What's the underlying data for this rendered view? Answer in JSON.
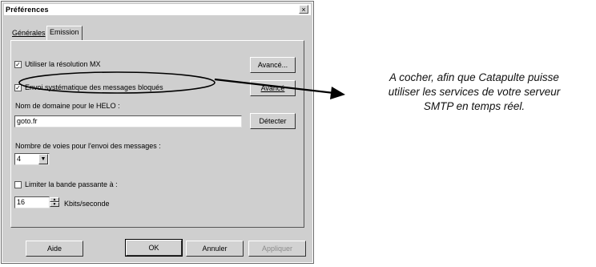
{
  "dialog": {
    "title": "Préférences",
    "close_label": "×",
    "tabs": [
      {
        "label": "Générales"
      },
      {
        "label": "Emission"
      }
    ],
    "checkbox_mx": {
      "label": "Utiliser la résolution MX",
      "checked": true
    },
    "checkbox_batch": {
      "label": "Envoi systématique des messages bloqués",
      "checked": true
    },
    "button_advanced_1": "Avancé...",
    "button_advanced_2": "Avancé",
    "helo_label": "Nom de domaine pour le HELO :",
    "helo_value": "goto.fr",
    "button_detect": "Détecter",
    "routes_label": "Nombre de voies pour l'envoi des messages :",
    "routes_value": "4",
    "checkbox_bandwidth": {
      "label": "Limiter la bande passante à :",
      "checked": false
    },
    "bandwidth_value": "16",
    "bandwidth_unit": "Kbits/seconde",
    "footer": {
      "help": "Aide",
      "ok": "OK",
      "cancel": "Annuler",
      "apply": "Appliquer"
    }
  },
  "annotation": {
    "lines": [
      "A cocher, afin que Catapulte puisse",
      "utiliser les services de votre serveur",
      "SMTP en temps réel."
    ]
  }
}
